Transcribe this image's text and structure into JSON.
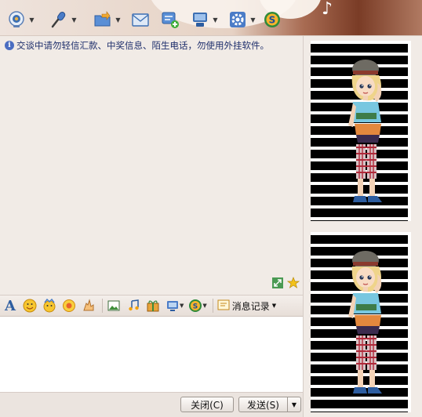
{
  "toolbar": {
    "items": [
      {
        "name": "video-call",
        "icon": "webcam-icon"
      },
      {
        "name": "voice-call",
        "icon": "microphone-icon"
      },
      {
        "name": "send-file",
        "icon": "folder-icon"
      },
      {
        "name": "send-mail",
        "icon": "mail-icon"
      },
      {
        "name": "add-app",
        "icon": "add-doc-icon"
      },
      {
        "name": "remote",
        "icon": "remote-icon"
      },
      {
        "name": "settings",
        "icon": "gear-icon"
      },
      {
        "name": "soso",
        "icon": "soso-icon"
      }
    ]
  },
  "chat": {
    "notice": "交谈中请勿轻信汇款、中奖信息、陌生电话，勿使用外挂软件。"
  },
  "format_toolbar": {
    "history_label": "消息记录"
  },
  "input": {
    "value": ""
  },
  "buttons": {
    "close_label": "关闭(C)",
    "send_label": "发送(S)"
  },
  "colors": {
    "notice_text": "#1f2f6c",
    "chat_bg": "#f1ebe6",
    "input_bg": "#ffffff"
  }
}
